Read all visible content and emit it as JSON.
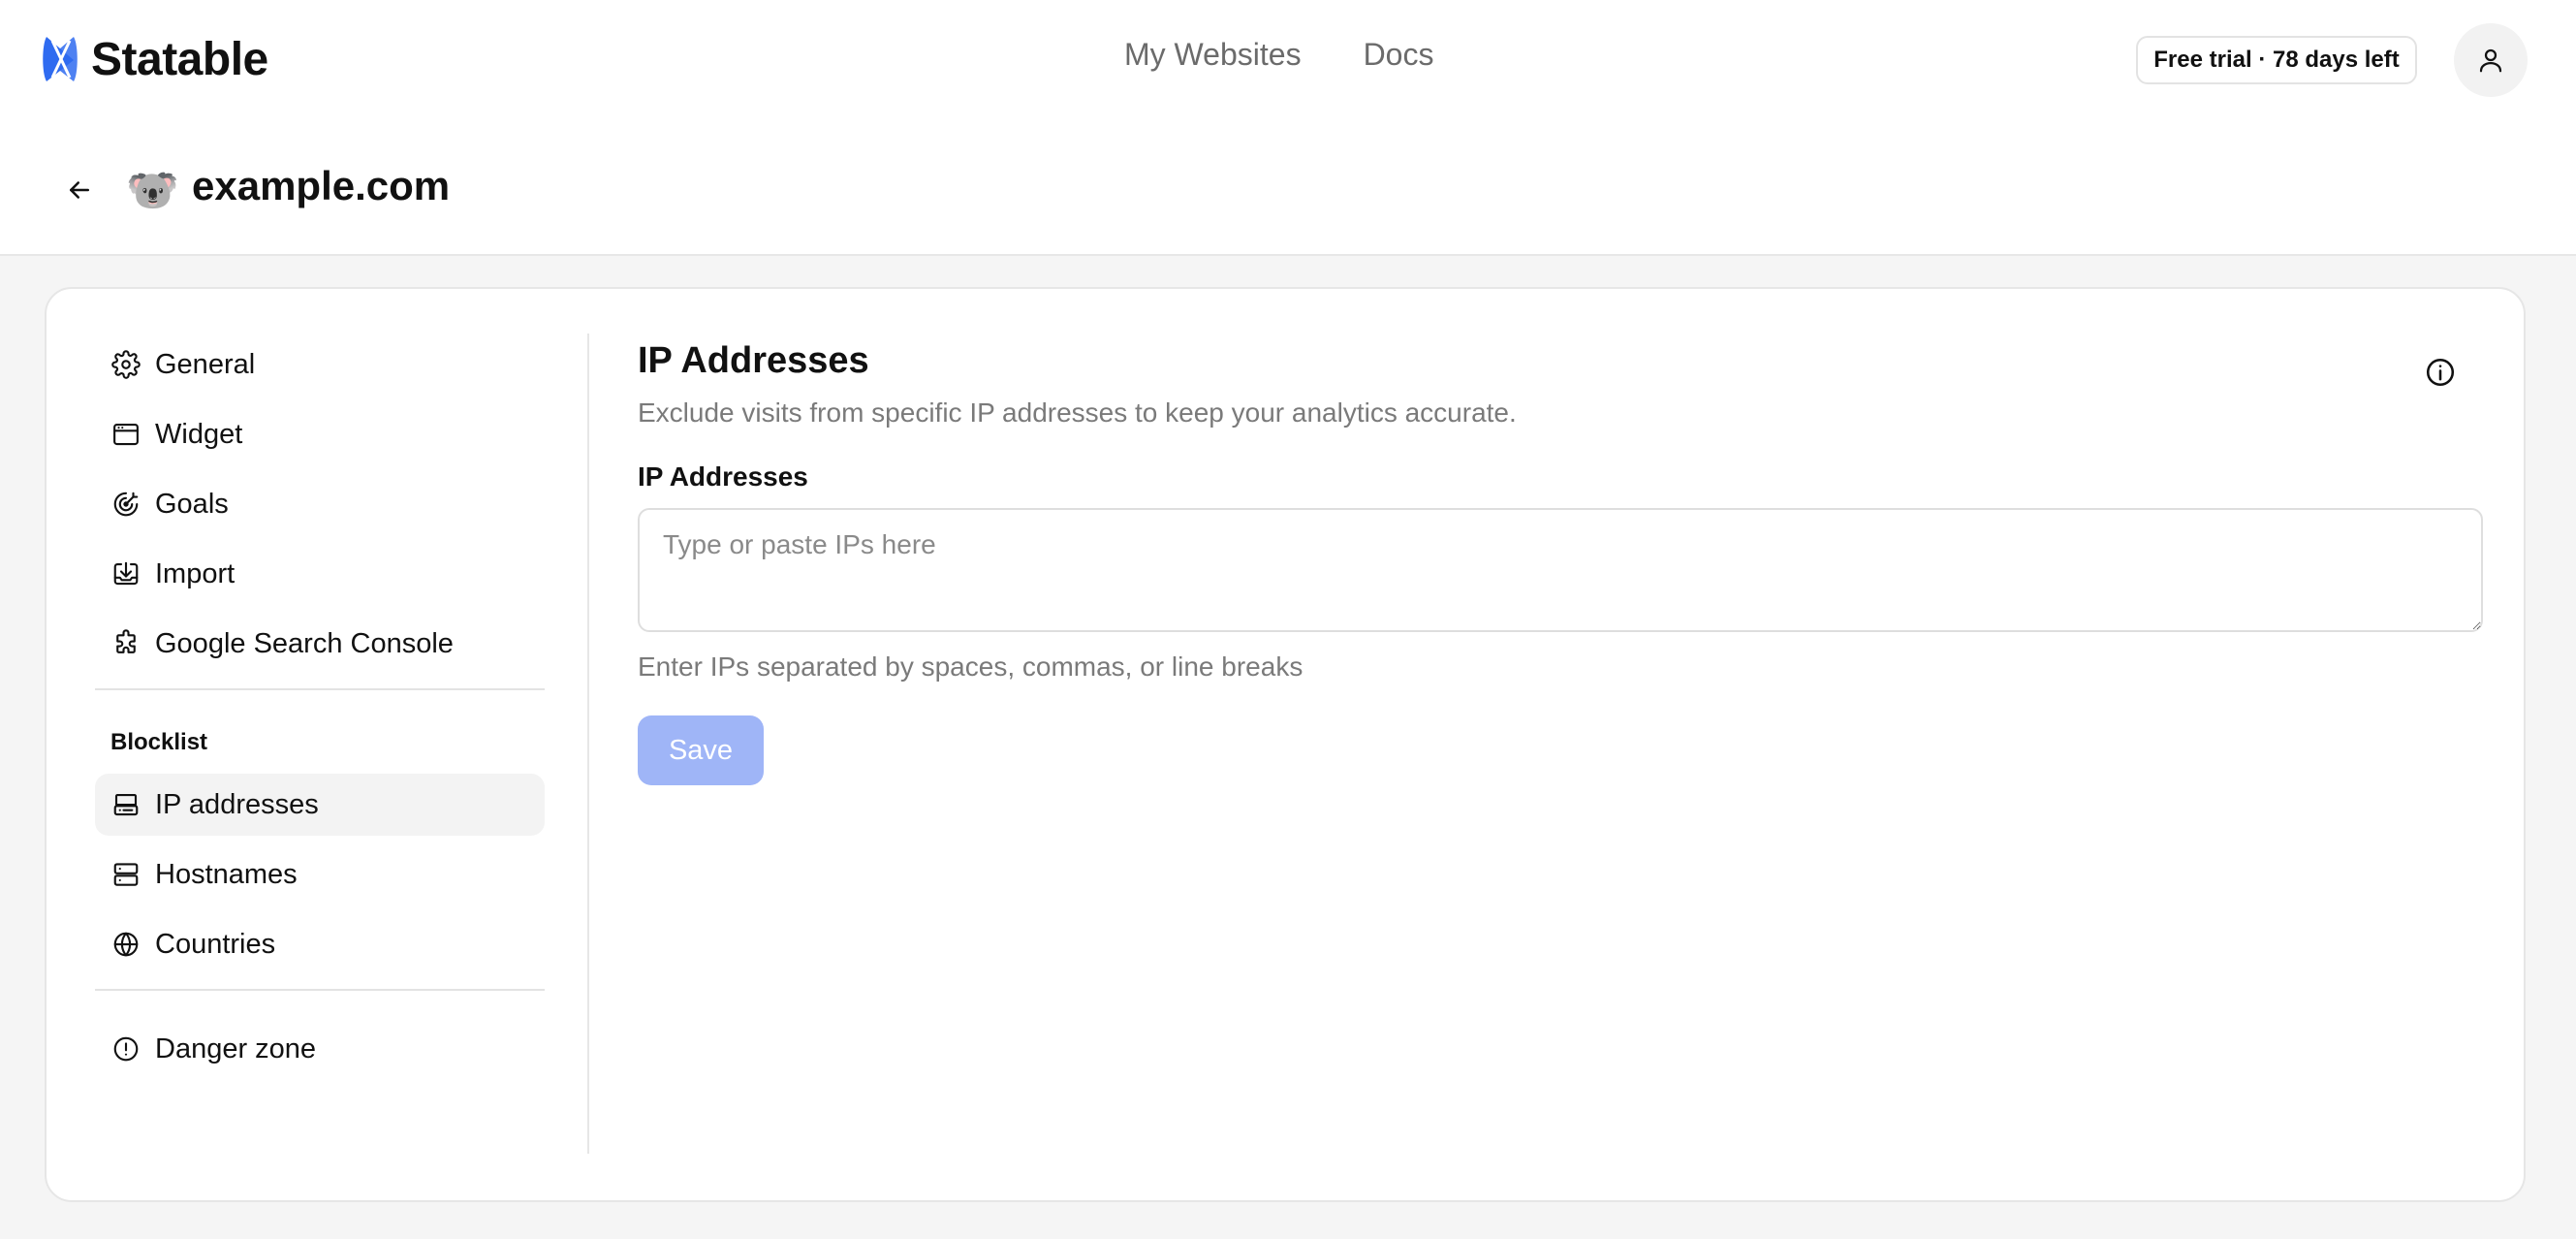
{
  "header": {
    "brand": "Statable",
    "brand_logo_icon": "statable-logo-icon",
    "nav": [
      {
        "label": "My Websites"
      },
      {
        "label": "Docs"
      }
    ],
    "trial_badge": "Free trial · 78 days left",
    "account_icon": "user-icon"
  },
  "site": {
    "favicon": "🐨",
    "name": "example.com",
    "back_icon": "arrow-left-icon"
  },
  "sidebar": {
    "items": [
      {
        "label": "General",
        "icon": "gear-icon"
      },
      {
        "label": "Widget",
        "icon": "browser-window-icon"
      },
      {
        "label": "Goals",
        "icon": "target-icon"
      },
      {
        "label": "Import",
        "icon": "import-tray-icon"
      },
      {
        "label": "Google Search Console",
        "icon": "puzzle-icon"
      }
    ],
    "blocklist_heading": "Blocklist",
    "blocklist_items": [
      {
        "label": "IP addresses",
        "icon": "ip-server-icon",
        "active": true
      },
      {
        "label": "Hostnames",
        "icon": "server-icon",
        "active": false
      },
      {
        "label": "Countries",
        "icon": "globe-icon",
        "active": false
      }
    ],
    "danger": {
      "label": "Danger zone",
      "icon": "alert-circle-icon"
    }
  },
  "content": {
    "title": "IP Addresses",
    "subtitle": "Exclude visits from specific IP addresses to keep your analytics accurate.",
    "info_icon": "info-icon",
    "field_label": "IP Addresses",
    "field_value": "",
    "field_placeholder": "Type or paste IPs here",
    "field_help": "Enter IPs separated by spaces, commas, or line breaks",
    "save_label": "Save"
  },
  "colors": {
    "brand": "#2f6bf0",
    "save_disabled": "#9fb5f7",
    "page_background": "#f5f5f5",
    "muted_text": "#7a7a7a"
  }
}
